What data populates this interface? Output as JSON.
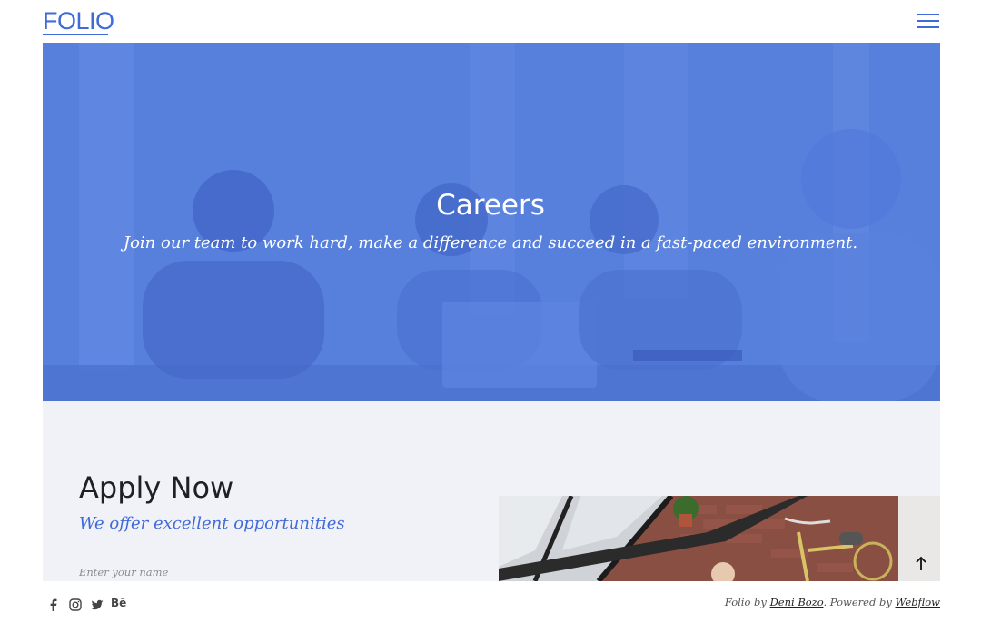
{
  "header": {
    "logo": "FOLIO"
  },
  "hero": {
    "title": "Careers",
    "subtitle": "Join our team to work hard, make a difference and succeed in a fast-paced environment."
  },
  "apply": {
    "title": "Apply Now",
    "subtitle": "We offer excellent opportunities",
    "name_placeholder": "Enter your name"
  },
  "footer": {
    "social_icons": [
      "facebook-icon",
      "instagram-icon",
      "twitter-icon",
      "behance-icon"
    ],
    "behance_label": "Bē",
    "credit_prefix": "Folio by ",
    "author_link": "Deni Bozo",
    "credit_middle": ". Powered by ",
    "platform_link": "Webflow"
  },
  "colors": {
    "accent": "#3f6ad8",
    "hero_overlay": "#5780dd",
    "section_bg": "#f1f1f8"
  }
}
